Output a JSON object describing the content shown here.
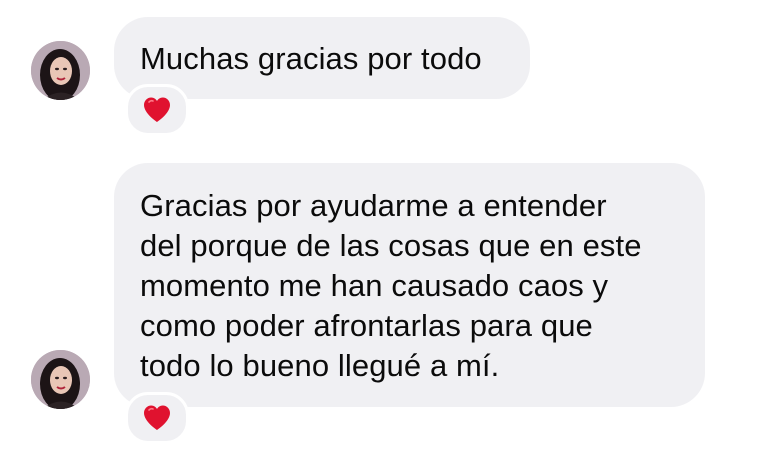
{
  "conversation": {
    "messages": [
      {
        "text": "Muchas gracias por todo",
        "reaction": "heart-icon",
        "reaction_color": "#e0122f",
        "avatar": "user-avatar"
      },
      {
        "text": "Gracias por ayudarme a entender\ndel porque de las cosas que en este\nmomento me han causado caos y\ncomo poder afrontarlas para que\ntodo lo bueno llegué a mí.",
        "reaction": "heart-icon",
        "reaction_color": "#e0122f",
        "avatar": "user-avatar"
      }
    ],
    "colors": {
      "bubble": "#f0f0f3",
      "text": "#0b0b0b",
      "background": "#ffffff"
    }
  }
}
